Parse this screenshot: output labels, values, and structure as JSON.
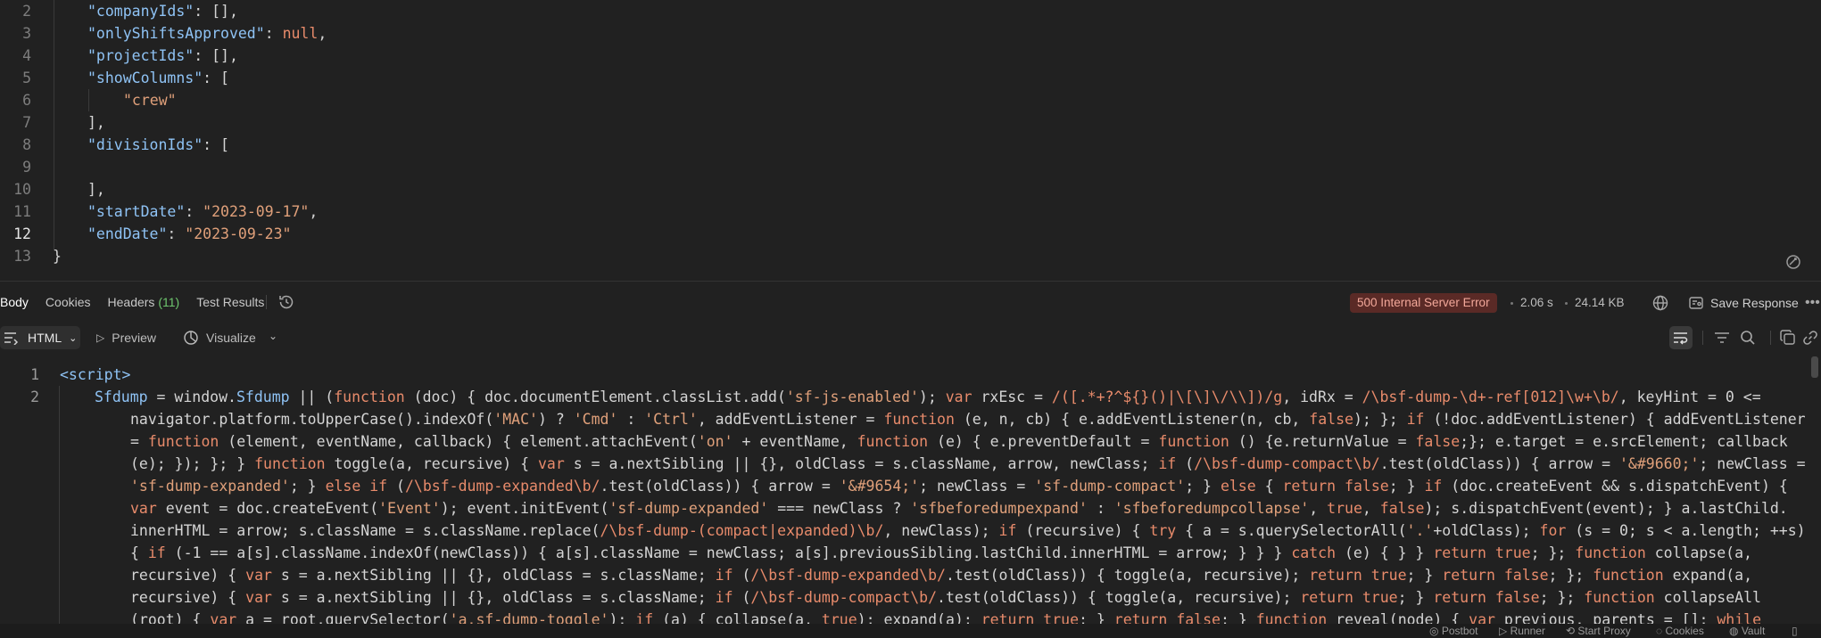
{
  "request_body": {
    "lines": [
      {
        "n": "2",
        "indent": 1,
        "parts": [
          {
            "t": "\"companyIds\"",
            "c": "key"
          },
          {
            "t": ": [],",
            "c": ""
          }
        ]
      },
      {
        "n": "3",
        "indent": 1,
        "parts": [
          {
            "t": "\"onlyShiftsApproved\"",
            "c": "key"
          },
          {
            "t": ": ",
            "c": ""
          },
          {
            "t": "null",
            "c": "nul"
          },
          {
            "t": ",",
            "c": ""
          }
        ]
      },
      {
        "n": "4",
        "indent": 1,
        "parts": [
          {
            "t": "\"projectIds\"",
            "c": "key"
          },
          {
            "t": ": [],",
            "c": ""
          }
        ]
      },
      {
        "n": "5",
        "indent": 1,
        "parts": [
          {
            "t": "\"showColumns\"",
            "c": "key"
          },
          {
            "t": ": [",
            "c": ""
          }
        ]
      },
      {
        "n": "6",
        "indent": 2,
        "parts": [
          {
            "t": "\"crew\"",
            "c": "str"
          }
        ]
      },
      {
        "n": "7",
        "indent": 1,
        "parts": [
          {
            "t": "],",
            "c": ""
          }
        ]
      },
      {
        "n": "8",
        "indent": 1,
        "parts": [
          {
            "t": "\"divisionIds\"",
            "c": "key"
          },
          {
            "t": ": [",
            "c": ""
          }
        ]
      },
      {
        "n": "9",
        "indent": 1,
        "parts": []
      },
      {
        "n": "10",
        "indent": 1,
        "parts": [
          {
            "t": "],",
            "c": ""
          }
        ]
      },
      {
        "n": "11",
        "indent": 1,
        "parts": [
          {
            "t": "\"startDate\"",
            "c": "key"
          },
          {
            "t": ": ",
            "c": ""
          },
          {
            "t": "\"2023-09-17\"",
            "c": "str"
          },
          {
            "t": ",",
            "c": ""
          }
        ]
      },
      {
        "n": "12",
        "indent": 1,
        "active": true,
        "parts": [
          {
            "t": "\"endDate\"",
            "c": "key"
          },
          {
            "t": ": ",
            "c": ""
          },
          {
            "t": "\"2023-09-23\"",
            "c": "str"
          }
        ]
      },
      {
        "n": "13",
        "indent": 0,
        "parts": [
          {
            "t": "}",
            "c": ""
          }
        ]
      }
    ]
  },
  "response": {
    "tabs": {
      "body": "Body",
      "cookies": "Cookies",
      "headers": "Headers",
      "headers_count": "(11)",
      "test_results": "Test Results"
    },
    "status": "500 Internal Server Error",
    "time": "2.06 s",
    "size": "24.14 KB",
    "save_label": "Save Response",
    "colors": {
      "error_bg": "#5a2a26",
      "error_text": "#f3a89a",
      "headers_count": "#6ec66e"
    }
  },
  "toolbar": {
    "format": "HTML",
    "preview": "Preview",
    "visualize": "Visualize"
  },
  "response_body": {
    "lines": [
      {
        "n": "1",
        "indent": 0,
        "parts": [
          {
            "t": "<script>",
            "c": "tag"
          }
        ]
      },
      {
        "n": "2",
        "indent": 1,
        "parts": [
          {
            "t": "Sfdump",
            "c": "fn"
          },
          {
            "t": " = window.",
            "c": ""
          },
          {
            "t": "Sfdump",
            "c": "fn"
          },
          {
            "t": " || (",
            "c": ""
          },
          {
            "t": "function",
            "c": "kw"
          },
          {
            "t": " (doc) { doc.documentElement.classList.add(",
            "c": ""
          },
          {
            "t": "'sf-js-enabled'",
            "c": "s2"
          },
          {
            "t": "); ",
            "c": ""
          },
          {
            "t": "var",
            "c": "kw"
          },
          {
            "t": " rxEsc = ",
            "c": ""
          },
          {
            "t": "/([.*+?^${}()|\\[\\]\\/\\\\])/g",
            "c": "rx"
          },
          {
            "t": ", idRx = ",
            "c": ""
          },
          {
            "t": "/\\bsf-dump-\\d+-ref[012]\\w+\\b/",
            "c": "rx"
          },
          {
            "t": ", keyHint = 0 <=",
            "c": ""
          }
        ]
      },
      {
        "n": "",
        "indent": 2,
        "parts": [
          {
            "t": "navigator.platform.toUpperCase().indexOf(",
            "c": ""
          },
          {
            "t": "'MAC'",
            "c": "s2"
          },
          {
            "t": ") ? ",
            "c": ""
          },
          {
            "t": "'Cmd'",
            "c": "s2"
          },
          {
            "t": " : ",
            "c": ""
          },
          {
            "t": "'Ctrl'",
            "c": "s2"
          },
          {
            "t": ", addEventListener = ",
            "c": ""
          },
          {
            "t": "function",
            "c": "kw"
          },
          {
            "t": " (e, n, cb) { e.addEventListener(n, cb, ",
            "c": ""
          },
          {
            "t": "false",
            "c": "kw"
          },
          {
            "t": "); }; ",
            "c": ""
          },
          {
            "t": "if",
            "c": "kw"
          },
          {
            "t": " (!doc.addEventListener) { addEventListener",
            "c": ""
          }
        ]
      },
      {
        "n": "",
        "indent": 2,
        "parts": [
          {
            "t": "= ",
            "c": ""
          },
          {
            "t": "function",
            "c": "kw"
          },
          {
            "t": " (element, eventName, callback) { element.attachEvent(",
            "c": ""
          },
          {
            "t": "'on'",
            "c": "s2"
          },
          {
            "t": " + eventName, ",
            "c": ""
          },
          {
            "t": "function",
            "c": "kw"
          },
          {
            "t": " (e) { e.preventDefault = ",
            "c": ""
          },
          {
            "t": "function",
            "c": "kw"
          },
          {
            "t": " () {e.returnValue = ",
            "c": ""
          },
          {
            "t": "false",
            "c": "kw"
          },
          {
            "t": ";}; e.target = e.srcElement; callback",
            "c": ""
          }
        ]
      },
      {
        "n": "",
        "indent": 2,
        "parts": [
          {
            "t": "(e); }); }; } ",
            "c": ""
          },
          {
            "t": "function",
            "c": "kw"
          },
          {
            "t": " toggle(a, recursive) { ",
            "c": ""
          },
          {
            "t": "var",
            "c": "kw"
          },
          {
            "t": " s = a.nextSibling || {}, oldClass = s.className, arrow, newClass; ",
            "c": ""
          },
          {
            "t": "if",
            "c": "kw"
          },
          {
            "t": " (",
            "c": ""
          },
          {
            "t": "/\\bsf-dump-compact\\b/",
            "c": "rx"
          },
          {
            "t": ".test(oldClass)) { arrow = ",
            "c": ""
          },
          {
            "t": "'&#9660;'",
            "c": "s2"
          },
          {
            "t": "; newClass =",
            "c": ""
          }
        ]
      },
      {
        "n": "",
        "indent": 2,
        "parts": [
          {
            "t": "'sf-dump-expanded'",
            "c": "s2"
          },
          {
            "t": "; } ",
            "c": ""
          },
          {
            "t": "else if",
            "c": "kw"
          },
          {
            "t": " (",
            "c": ""
          },
          {
            "t": "/\\bsf-dump-expanded\\b/",
            "c": "rx"
          },
          {
            "t": ".test(oldClass)) { arrow = ",
            "c": ""
          },
          {
            "t": "'&#9654;'",
            "c": "s2"
          },
          {
            "t": "; newClass = ",
            "c": ""
          },
          {
            "t": "'sf-dump-compact'",
            "c": "s2"
          },
          {
            "t": "; } ",
            "c": ""
          },
          {
            "t": "else",
            "c": "kw"
          },
          {
            "t": " { ",
            "c": ""
          },
          {
            "t": "return",
            "c": "kw"
          },
          {
            "t": " ",
            "c": ""
          },
          {
            "t": "false",
            "c": "kw"
          },
          {
            "t": "; } ",
            "c": ""
          },
          {
            "t": "if",
            "c": "kw"
          },
          {
            "t": " (doc.createEvent && s.dispatchEvent) {",
            "c": ""
          }
        ]
      },
      {
        "n": "",
        "indent": 2,
        "parts": [
          {
            "t": "var",
            "c": "kw"
          },
          {
            "t": " event = doc.createEvent(",
            "c": ""
          },
          {
            "t": "'Event'",
            "c": "s2"
          },
          {
            "t": "); event.initEvent(",
            "c": ""
          },
          {
            "t": "'sf-dump-expanded'",
            "c": "s2"
          },
          {
            "t": " === newClass ? ",
            "c": ""
          },
          {
            "t": "'sfbeforedumpexpand'",
            "c": "s2"
          },
          {
            "t": " : ",
            "c": ""
          },
          {
            "t": "'sfbeforedumpcollapse'",
            "c": "s2"
          },
          {
            "t": ", ",
            "c": ""
          },
          {
            "t": "true",
            "c": "kw"
          },
          {
            "t": ", ",
            "c": ""
          },
          {
            "t": "false",
            "c": "kw"
          },
          {
            "t": "); s.dispatchEvent(event); } a.lastChild.",
            "c": ""
          }
        ]
      },
      {
        "n": "",
        "indent": 2,
        "parts": [
          {
            "t": "innerHTML = arrow; s.className = s.className.replace(",
            "c": ""
          },
          {
            "t": "/\\bsf-dump-(compact|expanded)\\b/",
            "c": "rx"
          },
          {
            "t": ", newClass); ",
            "c": ""
          },
          {
            "t": "if",
            "c": "kw"
          },
          {
            "t": " (recursive) { ",
            "c": ""
          },
          {
            "t": "try",
            "c": "kw"
          },
          {
            "t": " { a = s.querySelectorAll(",
            "c": ""
          },
          {
            "t": "'.'",
            "c": "s2"
          },
          {
            "t": "+oldClass); ",
            "c": ""
          },
          {
            "t": "for",
            "c": "kw"
          },
          {
            "t": " (s = 0; s < a.length; ++s)",
            "c": ""
          }
        ]
      },
      {
        "n": "",
        "indent": 2,
        "parts": [
          {
            "t": "{ ",
            "c": ""
          },
          {
            "t": "if",
            "c": "kw"
          },
          {
            "t": " (-1 == a[s].className.indexOf(newClass)) { a[s].className = newClass; a[s].previousSibling.lastChild.innerHTML = arrow; } } } ",
            "c": ""
          },
          {
            "t": "catch",
            "c": "kw"
          },
          {
            "t": " (e) { } } ",
            "c": ""
          },
          {
            "t": "return",
            "c": "kw"
          },
          {
            "t": " ",
            "c": ""
          },
          {
            "t": "true",
            "c": "kw"
          },
          {
            "t": "; }; ",
            "c": ""
          },
          {
            "t": "function",
            "c": "kw"
          },
          {
            "t": " collapse(a,",
            "c": ""
          }
        ]
      },
      {
        "n": "",
        "indent": 2,
        "parts": [
          {
            "t": "recursive) { ",
            "c": ""
          },
          {
            "t": "var",
            "c": "kw"
          },
          {
            "t": " s = a.nextSibling || {}, oldClass = s.className; ",
            "c": ""
          },
          {
            "t": "if",
            "c": "kw"
          },
          {
            "t": " (",
            "c": ""
          },
          {
            "t": "/\\bsf-dump-expanded\\b/",
            "c": "rx"
          },
          {
            "t": ".test(oldClass)) { toggle(a, recursive); ",
            "c": ""
          },
          {
            "t": "return",
            "c": "kw"
          },
          {
            "t": " ",
            "c": ""
          },
          {
            "t": "true",
            "c": "kw"
          },
          {
            "t": "; } ",
            "c": ""
          },
          {
            "t": "return",
            "c": "kw"
          },
          {
            "t": " ",
            "c": ""
          },
          {
            "t": "false",
            "c": "kw"
          },
          {
            "t": "; }; ",
            "c": ""
          },
          {
            "t": "function",
            "c": "kw"
          },
          {
            "t": " expand(a,",
            "c": ""
          }
        ]
      },
      {
        "n": "",
        "indent": 2,
        "parts": [
          {
            "t": "recursive) { ",
            "c": ""
          },
          {
            "t": "var",
            "c": "kw"
          },
          {
            "t": " s = a.nextSibling || {}, oldClass = s.className; ",
            "c": ""
          },
          {
            "t": "if",
            "c": "kw"
          },
          {
            "t": " (",
            "c": ""
          },
          {
            "t": "/\\bsf-dump-compact\\b/",
            "c": "rx"
          },
          {
            "t": ".test(oldClass)) { toggle(a, recursive); ",
            "c": ""
          },
          {
            "t": "return",
            "c": "kw"
          },
          {
            "t": " ",
            "c": ""
          },
          {
            "t": "true",
            "c": "kw"
          },
          {
            "t": "; } ",
            "c": ""
          },
          {
            "t": "return",
            "c": "kw"
          },
          {
            "t": " ",
            "c": ""
          },
          {
            "t": "false",
            "c": "kw"
          },
          {
            "t": "; }; ",
            "c": ""
          },
          {
            "t": "function",
            "c": "kw"
          },
          {
            "t": " collapseAll",
            "c": ""
          }
        ]
      },
      {
        "n": "",
        "indent": 2,
        "parts": [
          {
            "t": "(root) { ",
            "c": ""
          },
          {
            "t": "var",
            "c": "kw"
          },
          {
            "t": " a = root.querySelector(",
            "c": ""
          },
          {
            "t": "'a.sf-dump-toggle'",
            "c": "s2"
          },
          {
            "t": "); ",
            "c": ""
          },
          {
            "t": "if",
            "c": "kw"
          },
          {
            "t": " (a) { collapse(a, ",
            "c": ""
          },
          {
            "t": "true",
            "c": "kw"
          },
          {
            "t": "); expand(a); ",
            "c": ""
          },
          {
            "t": "return",
            "c": "kw"
          },
          {
            "t": " ",
            "c": ""
          },
          {
            "t": "true",
            "c": "kw"
          },
          {
            "t": "; } ",
            "c": ""
          },
          {
            "t": "return",
            "c": "kw"
          },
          {
            "t": " ",
            "c": ""
          },
          {
            "t": "false",
            "c": "kw"
          },
          {
            "t": "; } ",
            "c": ""
          },
          {
            "t": "function",
            "c": "kw"
          },
          {
            "t": " reveal(node) { ",
            "c": ""
          },
          {
            "t": "var",
            "c": "kw"
          },
          {
            "t": " previous, parents = []; ",
            "c": ""
          },
          {
            "t": "while",
            "c": "kw"
          }
        ]
      }
    ]
  },
  "statusbar": {
    "postbot": "Postbot",
    "runner": "Runner",
    "start_proxy": "Start Proxy",
    "cookies": "Cookies",
    "vault": "Vault"
  }
}
